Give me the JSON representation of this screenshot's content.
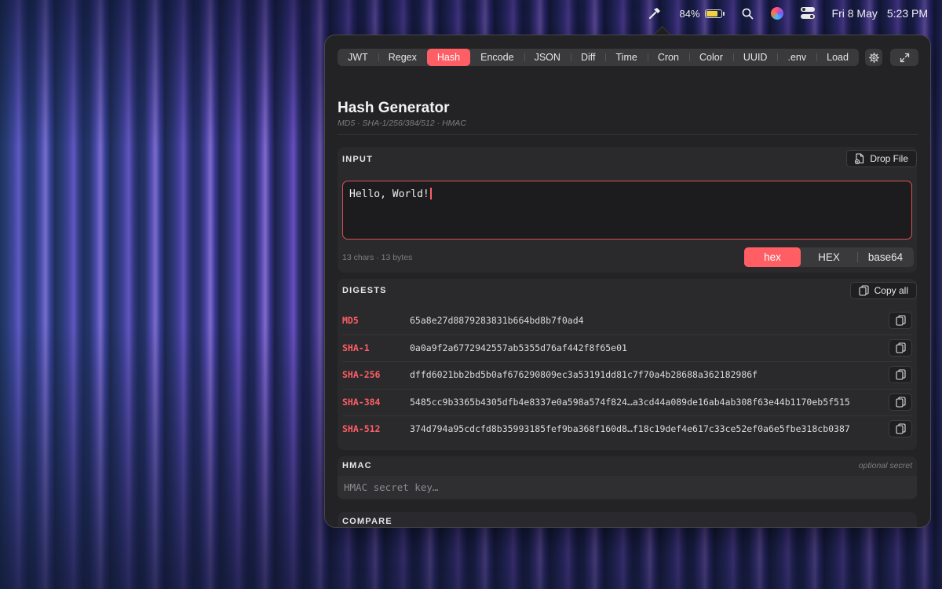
{
  "menubar": {
    "battery_percent": "84%",
    "battery_level": 0.84,
    "date": "Fri 8 May",
    "time": "5:23 PM"
  },
  "tabs": [
    {
      "label": "JWT"
    },
    {
      "label": "Regex"
    },
    {
      "label": "Hash",
      "active": true
    },
    {
      "label": "Encode"
    },
    {
      "label": "JSON"
    },
    {
      "label": "Diff"
    },
    {
      "label": "Time"
    },
    {
      "label": "Cron"
    },
    {
      "label": "Color"
    },
    {
      "label": "UUID"
    },
    {
      "label": ".env"
    },
    {
      "label": "Load"
    }
  ],
  "header": {
    "title": "Hash Generator",
    "subtitle": "MD5 · SHA-1/256/384/512 · HMAC"
  },
  "input": {
    "label": "INPUT",
    "drop_file_label": "Drop File",
    "value": "Hello, World!",
    "counts": "13 chars · 13 bytes",
    "formats": [
      "hex",
      "HEX",
      "base64"
    ],
    "selected_format": "hex"
  },
  "digests": {
    "label": "DIGESTS",
    "copy_all_label": "Copy all",
    "rows": [
      {
        "algo": "MD5",
        "value": "65a8e27d8879283831b664bd8b7f0ad4"
      },
      {
        "algo": "SHA-1",
        "value": "0a0a9f2a6772942557ab5355d76af442f8f65e01"
      },
      {
        "algo": "SHA-256",
        "value": "dffd6021bb2bd5b0af676290809ec3a53191dd81c7f70a4b28688a362182986f"
      },
      {
        "algo": "SHA-384",
        "value": "5485cc9b3365b4305dfb4e8337e0a598a574f824…a3cd44a089de16ab4ab308f63e44b1170eb5f515"
      },
      {
        "algo": "SHA-512",
        "value": "374d794a95cdcfd8b35993185fef9ba368f160d8…f18c19def4e617c33ce52ef0a6e5fbe318cb0387"
      }
    ]
  },
  "hmac": {
    "label": "HMAC",
    "note": "optional secret",
    "placeholder": "HMAC secret key…"
  },
  "compare": {
    "label": "COMPARE"
  },
  "colors": {
    "accent": "#ff5f64",
    "panel": "#232325",
    "section": "#2a2a2c"
  }
}
